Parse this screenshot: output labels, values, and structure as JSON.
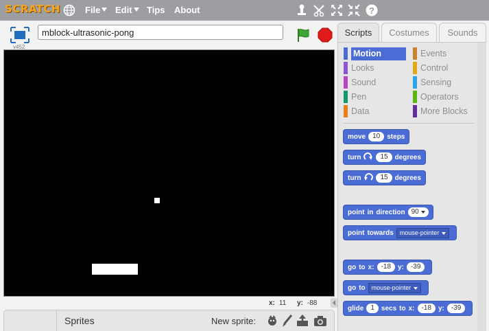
{
  "menubar": {
    "logo": "SCRATCH",
    "file_label": "File",
    "edit_label": "Edit",
    "tips_label": "Tips",
    "about_label": "About",
    "icons": [
      "globe-icon",
      "duplicate-icon",
      "cut-icon",
      "grow-icon",
      "shrink-icon",
      "help-icon"
    ]
  },
  "stage": {
    "version": "v452",
    "project_title": "mblock-ultrasonic-pong",
    "mouse_x_label": "x:",
    "mouse_x": "11",
    "mouse_y_label": "y:",
    "mouse_y": "-88"
  },
  "sprites_pane": {
    "label": "Sprites",
    "new_sprite_label": "New sprite:",
    "icons": [
      "sprite-library-icon",
      "paint-brush-icon",
      "upload-icon",
      "camera-icon"
    ]
  },
  "tabs": [
    "Scripts",
    "Costumes",
    "Sounds"
  ],
  "categories": [
    {
      "label": "Motion",
      "color": "#4a6cd4"
    },
    {
      "label": "Looks",
      "color": "#8a55d7"
    },
    {
      "label": "Sound",
      "color": "#bb42c3"
    },
    {
      "label": "Pen",
      "color": "#0e9a6c"
    },
    {
      "label": "Data",
      "color": "#ee7d16"
    },
    {
      "label": "Events",
      "color": "#c88330"
    },
    {
      "label": "Control",
      "color": "#e1a91a"
    },
    {
      "label": "Sensing",
      "color": "#2ca5e2"
    },
    {
      "label": "Operators",
      "color": "#5cb712"
    },
    {
      "label": "More Blocks",
      "color": "#632d99"
    }
  ],
  "blocks": {
    "move": {
      "w1": "move",
      "v1": "10",
      "w2": "steps"
    },
    "turn_right": {
      "w1": "turn",
      "v1": "15",
      "w2": "degrees"
    },
    "turn_left": {
      "w1": "turn",
      "v1": "15",
      "w2": "degrees"
    },
    "point_dir": {
      "w1": "point",
      "w2": "in",
      "w3": "direction",
      "v1": "90"
    },
    "point_towards": {
      "w1": "point",
      "w2": "towards",
      "d1": "mouse-pointer"
    },
    "goto_xy": {
      "w1": "go",
      "w2": "to",
      "w3": "x:",
      "v1": "-18",
      "w4": "y:",
      "v2": "-39"
    },
    "goto": {
      "w1": "go",
      "w2": "to",
      "d1": "mouse-pointer"
    },
    "glide": {
      "w1": "glide",
      "v1": "1",
      "w2": "secs",
      "w3": "to",
      "w4": "x:",
      "v2": "-18",
      "w5": "y:",
      "v3": "-39"
    }
  }
}
